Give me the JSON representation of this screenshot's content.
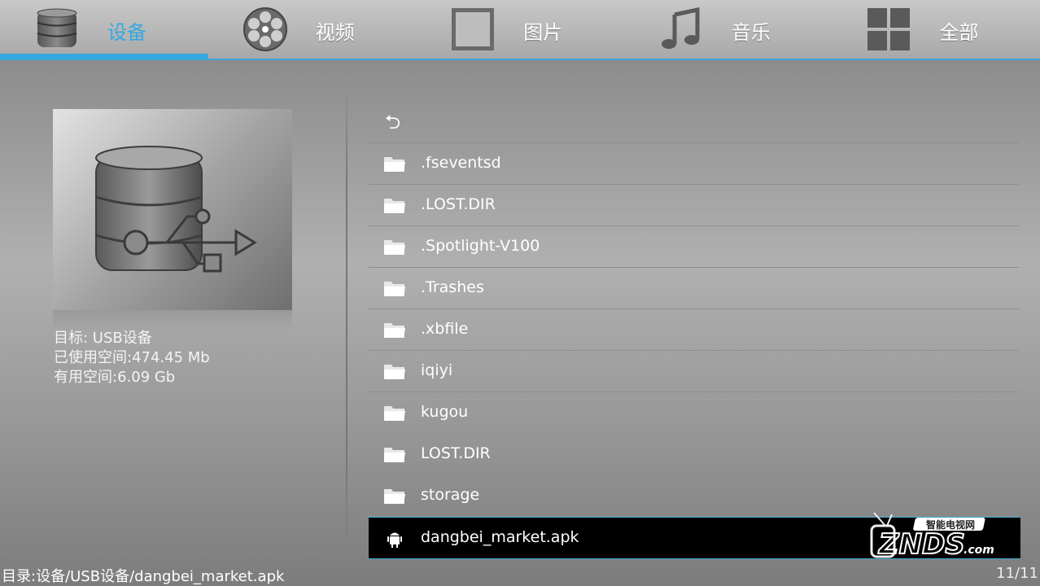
{
  "tabs": [
    {
      "label": "设备",
      "icon": "database-icon",
      "active": true
    },
    {
      "label": "视频",
      "icon": "film-reel-icon",
      "active": false
    },
    {
      "label": "图片",
      "icon": "picture-frame-icon",
      "active": false
    },
    {
      "label": "音乐",
      "icon": "music-note-icon",
      "active": false
    },
    {
      "label": "全部",
      "icon": "grid-icon",
      "active": false
    }
  ],
  "device": {
    "image_icon": "usb-storage-icon",
    "target": "目标: USB设备",
    "used": "已使用空间:474.45 Mb",
    "free": "有用空间:6.09 Gb"
  },
  "files": {
    "back_icon": "back-arrow-icon",
    "items": [
      {
        "name": ".fseventsd",
        "type": "folder"
      },
      {
        "name": ".LOST.DIR",
        "type": "folder"
      },
      {
        "name": ".Spotlight-V100",
        "type": "folder"
      },
      {
        "name": ".Trashes",
        "type": "folder"
      },
      {
        "name": ".xbfile",
        "type": "folder"
      },
      {
        "name": "iqiyi",
        "type": "folder"
      },
      {
        "name": "kugou",
        "type": "folder"
      },
      {
        "name": "LOST.DIR",
        "type": "folder"
      },
      {
        "name": "storage",
        "type": "folder"
      },
      {
        "name": "dangbei_market.apk",
        "type": "apk",
        "selected": true
      }
    ]
  },
  "status": {
    "path": "目录:设备/USB设备/dangbei_market.apk",
    "count": "11/11"
  },
  "watermark": {
    "top_text": "智能电视网",
    "main_text": "ZNDS",
    "suffix": ".com"
  },
  "colors": {
    "accent": "#35a8de",
    "selected_bg": "#000000"
  }
}
